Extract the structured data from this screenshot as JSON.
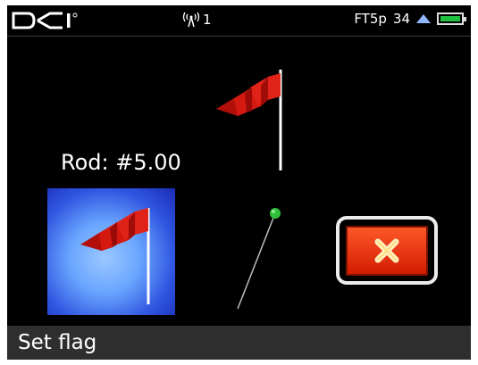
{
  "status": {
    "brand": "DCI",
    "signal_value": "1",
    "frequency": "FT5p",
    "channel": "34",
    "battery": "full"
  },
  "main": {
    "rod_label": "Rod: #5.00"
  },
  "bottom": {
    "label": "Set flag"
  },
  "icons": [
    "dci-logo-icon",
    "antenna-signal-icon",
    "up-arrow-icon",
    "battery-icon",
    "red-flag-icon",
    "tilt-indicator-icon",
    "close-icon"
  ],
  "colors": {
    "flag": "#d41a10",
    "flag_button_bg": "#4f7ff0",
    "cancel": "#e8380f",
    "battery": "#22c040",
    "bottom_bar": "#2e2e2e"
  }
}
